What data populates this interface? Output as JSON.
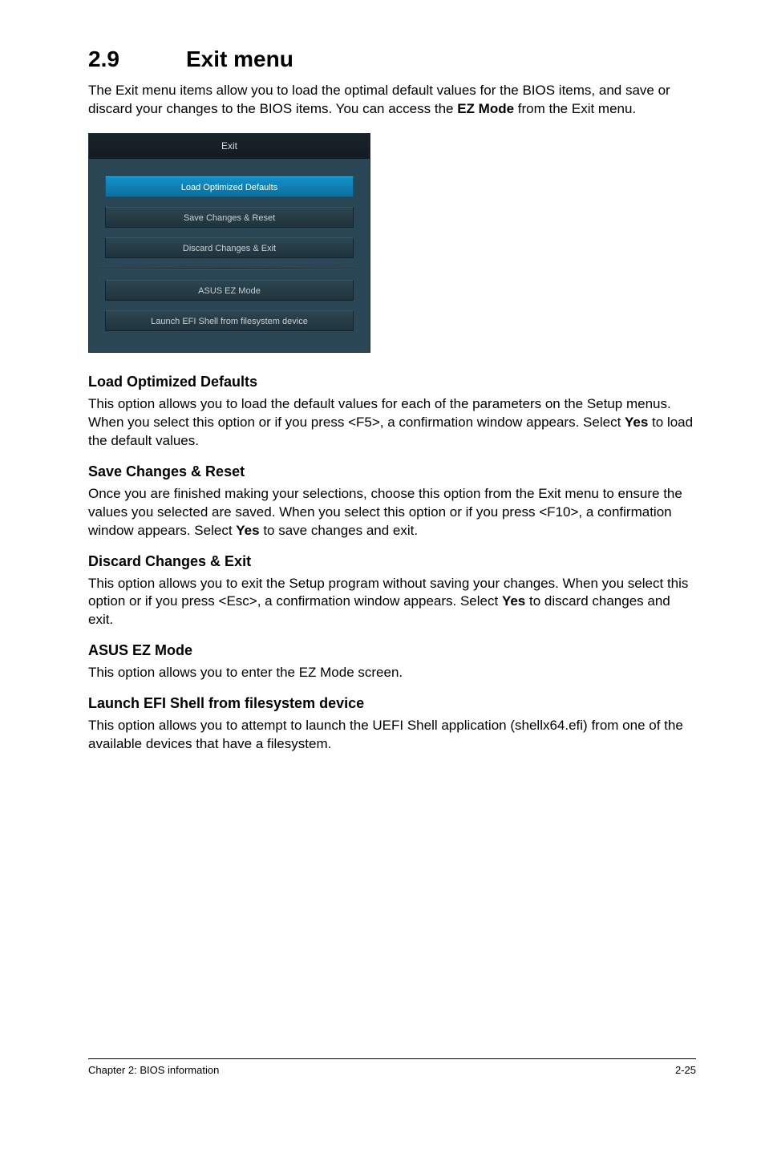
{
  "section": {
    "number": "2.9",
    "title": "Exit menu"
  },
  "intro": {
    "pre": "The Exit menu items allow you to load the optimal default values for the BIOS items, and save or discard your changes to the BIOS items. You can access the ",
    "bold": "EZ Mode",
    "post": " from the Exit menu."
  },
  "exit_panel": {
    "title": "Exit",
    "buttons_top": [
      {
        "label": "Load Optimized Defaults",
        "selected": true
      },
      {
        "label": "Save Changes & Reset",
        "selected": false
      },
      {
        "label": "Discard Changes & Exit",
        "selected": false
      }
    ],
    "buttons_bottom": [
      {
        "label": "ASUS EZ Mode",
        "selected": false
      },
      {
        "label": "Launch EFI Shell from filesystem device",
        "selected": false
      }
    ]
  },
  "sections": {
    "load_defaults": {
      "heading": "Load Optimized Defaults",
      "p1_pre": "This option allows you to load the default values for each of the parameters on the Setup menus. When you select this option or if you press <F5>, a confirmation window appears. Select ",
      "p1_bold": "Yes",
      "p1_post": " to load the default values."
    },
    "save_reset": {
      "heading": "Save Changes & Reset",
      "p1_pre": "Once you are finished making your selections, choose this option from the Exit menu to ensure the values you selected are saved. When you select this option or if you press <F10>, a confirmation window appears. Select ",
      "p1_bold": "Yes",
      "p1_post": " to save changes and exit."
    },
    "discard_exit": {
      "heading": "Discard Changes & Exit",
      "p1_pre": "This option allows you to exit the Setup program without saving your changes. When you select this option or if you press <Esc>, a confirmation window appears. Select ",
      "p1_bold": "Yes",
      "p1_post": " to discard changes and exit."
    },
    "ez_mode": {
      "heading": "ASUS EZ Mode",
      "p1": "This option allows you to enter the EZ Mode screen."
    },
    "efi_shell": {
      "heading": "Launch EFI Shell from filesystem device",
      "p1": "This option allows you to attempt to launch the UEFI Shell application (shellx64.efi) from one of the available devices that have a filesystem."
    }
  },
  "footer": {
    "left": "Chapter 2: BIOS information",
    "right": "2-25"
  }
}
